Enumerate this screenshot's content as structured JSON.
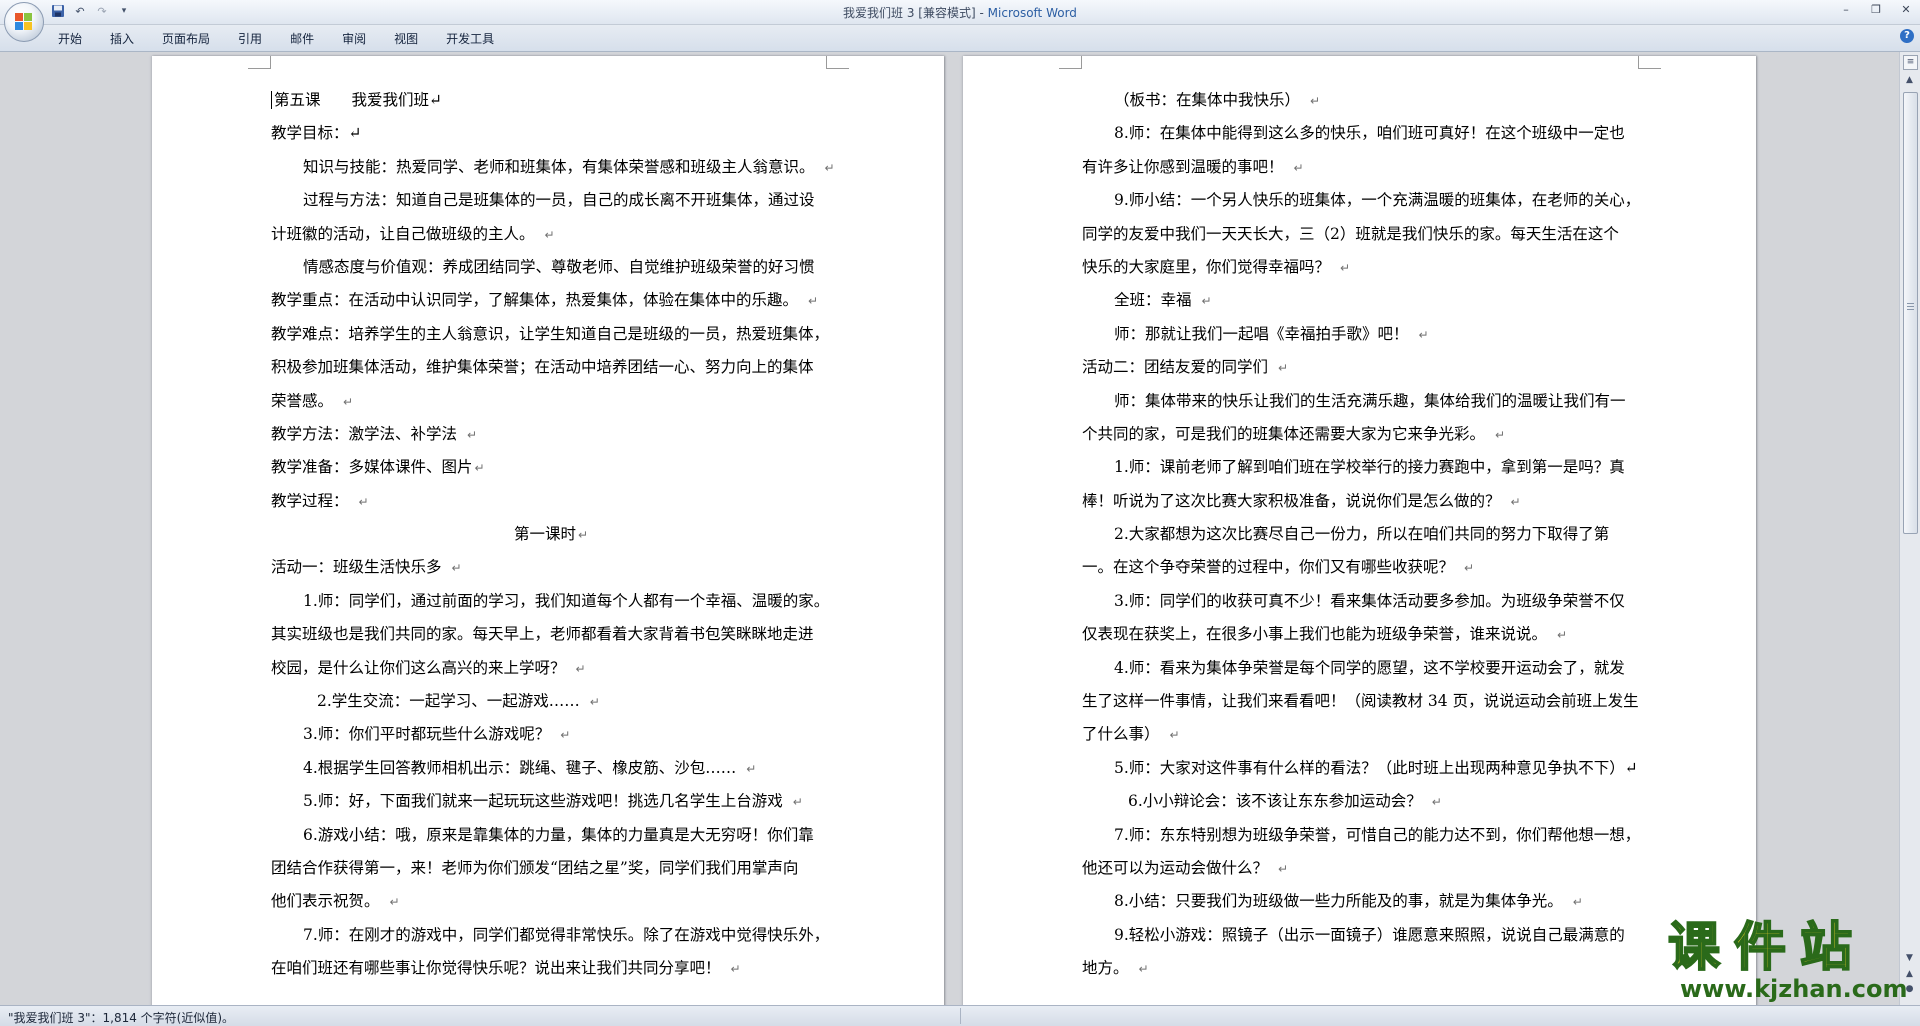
{
  "window": {
    "title": "我爱我们班 3 [兼容模式]",
    "title_sep": " - ",
    "app_name": "Microsoft Word",
    "controls": [
      "–",
      "❐",
      "✕"
    ]
  },
  "quick_access": {
    "save_icon": "save-icon",
    "undo": "↶",
    "redo": "↷",
    "customize": "▾"
  },
  "ribbon": {
    "tabs": [
      "开始",
      "插入",
      "页面布局",
      "引用",
      "邮件",
      "审阅",
      "视图",
      "开发工具"
    ],
    "help": "?"
  },
  "document": {
    "left_page": [
      "第五课　　我爱我们班↵",
      "教学目标：↵",
      "知识与技能：热爱同学、老师和班集体，有集体荣誉感和班级主人翁意识。",
      "过程与方法：知道自己是班集体的一员，自己的成长离不开班集体，通过设",
      "计班徽的活动，让自己做班级的主人。",
      "情感态度与价值观：养成团结同学、尊敬老师、自觉维护班级荣誉的好习惯",
      "教学重点：在活动中认识同学，了解集体，热爱集体，体验在集体中的乐趣。",
      "教学难点：培养学生的主人翁意识，让学生知道自己是班级的一员，热爱班集体，",
      "积极参加班集体活动，维护集体荣誉；在活动中培养团结一心、努力向上的集体",
      "荣誉感。",
      "教学方法：激学法、补学法",
      "教学准备：多媒体课件、图片",
      "教学过程：",
      "第一课时",
      "活动一：班级生活快乐多",
      "1.师：同学们，通过前面的学习，我们知道每个人都有一个幸福、温暖的家。",
      "其实班级也是我们共同的家。每天早上，老师都看着大家背着书包笑眯眯地走进",
      "校园，是什么让你们这么高兴的来上学呀？",
      "2.学生交流：一起学习、一起游戏……",
      "3.师：你们平时都玩些什么游戏呢？",
      "4.根据学生回答教师相机出示：跳绳、毽子、橡皮筋、沙包……",
      "5.师：好，下面我们就来一起玩玩这些游戏吧！挑选几名学生上台游戏",
      "6.游戏小结：哦，原来是靠集体的力量，集体的力量真是大无穷呀！你们靠",
      "团结合作获得第一，来！老师为你们颁发“团结之星”奖，同学们我们用掌声向",
      "他们表示祝贺。",
      "7.师：在刚才的游戏中，同学们都觉得非常快乐。除了在游戏中觉得快乐外，",
      "在咱们班还有哪些事让你觉得快乐呢？说出来让我们共同分享吧！"
    ],
    "right_page": [
      "（板书：在集体中我快乐）",
      "8.师：在集体中能得到这么多的快乐，咱们班可真好！在这个班级中一定也",
      "有许多让你感到温暖的事吧！",
      "9.师小结：一个另人快乐的班集体，一个充满温暖的班集体，在老师的关心，",
      "同学的友爱中我们一天天长大，三（2）班就是我们快乐的家。每天生活在这个",
      "快乐的大家庭里，你们觉得幸福吗？",
      "全班：幸福",
      "师：那就让我们一起唱《幸福拍手歌》吧！",
      "活动二：团结友爱的同学们",
      "师：集体带来的快乐让我们的生活充满乐趣，集体给我们的温暖让我们有一",
      "个共同的家，可是我们的班集体还需要大家为它来争光彩。",
      "1.师：课前老师了解到咱们班在学校举行的接力赛跑中，拿到第一是吗？真",
      "棒！听说为了这次比赛大家积极准备，说说你们是怎么做的？",
      "2.大家都想为这次比赛尽自己一份力，所以在咱们共同的努力下取得了第",
      "一。在这个争夺荣誉的过程中，你们又有哪些收获呢？",
      "3.师：同学们的收获可真不少！看来集体活动要多参加。为班级争荣誉不仅",
      "仅表现在获奖上，在很多小事上我们也能为班级争荣誉，谁来说说。",
      "4.师：看来为集体争荣誉是每个同学的愿望，这不学校要开运动会了，就发",
      "生了这样一件事情，让我们来看看吧！（阅读教材 34 页，说说运动会前班上发生",
      "了什么事）",
      "5.师：大家对这件事有什么样的看法？（此时班上出现两种意见争执不下）↵",
      "6.小小辩论会：该不该让东东参加运动会？",
      "7.师：东东特别想为班级争荣誉，可惜自己的能力达不到，你们帮他想一想，",
      "他还可以为运动会做什么？",
      "8.小结：只要我们为班级做一些力所能及的事，就是为集体争光。",
      "9.轻松小游戏：照镜子（出示一面镜子）谁愿意来照照，说说自己最满意的",
      "地方。"
    ],
    "paragraph_mark": "↵"
  },
  "status_bar": {
    "text": "\"我爱我们班 3\"：1,814 个字符(近似值)。"
  },
  "watermark": {
    "main": "课件站",
    "url": "www.kjzhan.com"
  },
  "colors": {
    "app_name": "#2c5ea3",
    "watermark_fill": "#f0d12a",
    "watermark_outline": "#2a6a1a"
  }
}
